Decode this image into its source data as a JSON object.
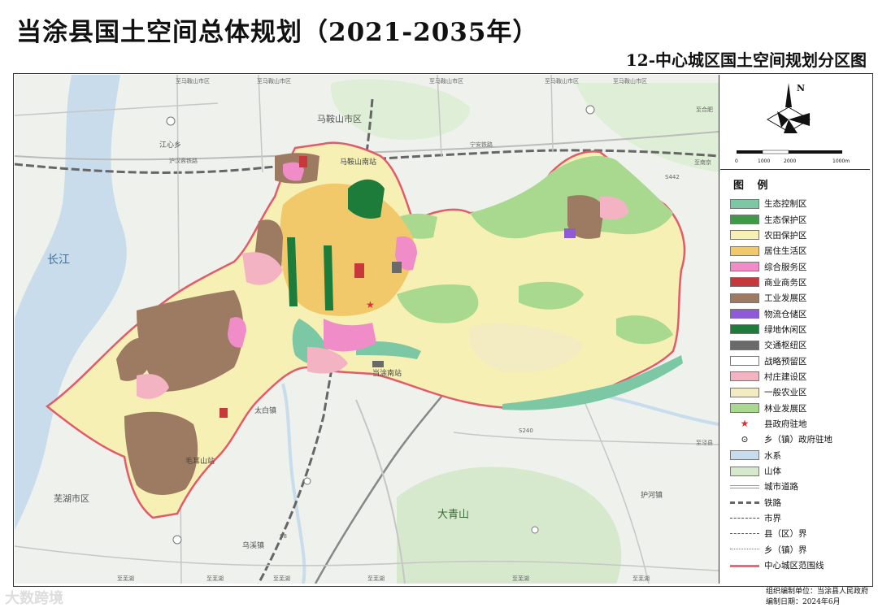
{
  "header": {
    "title": "当涂县国土空间总体规划（2021-2035年）",
    "subtitle": "12-中心城区国土空间规划分区图"
  },
  "compass": {
    "north_label": "N",
    "scale_labels": [
      "0",
      "1000",
      "2000",
      "1000m"
    ]
  },
  "map": {
    "labels": {
      "changjiang": "长江",
      "maanshan": "马鞍山市区",
      "wuhu": "芜湖市区",
      "daqingshan": "大青山",
      "jiangxin": "江心乡",
      "taibai": "太白镇",
      "huyang": "护河镇",
      "wuling": "乌溪镇",
      "dangtu_station": "当涂南站",
      "maanshan_south": "马鞍山南站",
      "maershan": "毛耳山站"
    },
    "road_labels": {
      "zhima_top": "至马鞍山市区",
      "zhima_top2": "至马鞍山市区",
      "zhima_top3": "至马鞍山市区",
      "zhima_top4": "至马鞍山市区",
      "zhima_top5": "至马鞍山市区",
      "zhihe": "至合肥",
      "zhishui": "至泾县",
      "zhinanjing": "至南京",
      "zhiwuhu_b1": "至芜湖",
      "zhiwuhu_b2": "至芜湖",
      "zhiwuhu_b3": "至芜湖",
      "zhiwuhu_b4": "至芜湖",
      "zhiwuhu_b5": "至芜湖",
      "zhiwuhu_b6": "至芜湖",
      "huhan": "沪汉蓉铁路",
      "ningan": "宁安铁路",
      "s442": "S442",
      "s240": "S240",
      "s8": "S8"
    },
    "colors": {
      "background": "#eef1ec",
      "water": "#c9dcec",
      "mountain": "#d7e9cc",
      "eco_control": "#7dc8a4",
      "eco_protect": "#3f9a47",
      "farmland": "#f7f0b4",
      "residential": "#f2c96a",
      "comprehensive": "#f08cc8",
      "commercial": "#c8373a",
      "industrial": "#9c7b62",
      "logistics": "#8e5ad8",
      "green_leisure": "#1d7c3a",
      "transport": "#6a6a6a",
      "strategic": "#ffffff",
      "village": "#f4b3c2",
      "general_agri": "#f3ebc2",
      "forestry": "#a9d98e",
      "boundary": "#e35a6a"
    }
  },
  "legend": {
    "title": "图  例",
    "items": [
      {
        "label": "生态控制区",
        "kind": "fill",
        "color": "#7dc8a4"
      },
      {
        "label": "生态保护区",
        "kind": "fill",
        "color": "#3f9a47"
      },
      {
        "label": "农田保护区",
        "kind": "fill",
        "color": "#f7f0b4"
      },
      {
        "label": "居住生活区",
        "kind": "fill",
        "color": "#f2c96a"
      },
      {
        "label": "综合服务区",
        "kind": "fill",
        "color": "#f08cc8"
      },
      {
        "label": "商业商务区",
        "kind": "fill",
        "color": "#c8373a"
      },
      {
        "label": "工业发展区",
        "kind": "fill",
        "color": "#9c7b62"
      },
      {
        "label": "物流仓储区",
        "kind": "fill",
        "color": "#8e5ad8"
      },
      {
        "label": "绿地休闲区",
        "kind": "fill",
        "color": "#1d7c3a"
      },
      {
        "label": "交通枢纽区",
        "kind": "fill",
        "color": "#6a6a6a"
      },
      {
        "label": "战略预留区",
        "kind": "fill",
        "color": "#ffffff"
      },
      {
        "label": "村庄建设区",
        "kind": "fill",
        "color": "#f4b3c2"
      },
      {
        "label": "一般农业区",
        "kind": "fill",
        "color": "#f3ebc2"
      },
      {
        "label": "林业发展区",
        "kind": "fill",
        "color": "#a9d98e"
      },
      {
        "label": "县政府驻地",
        "kind": "star",
        "color": "#e0303a"
      },
      {
        "label": "乡（镇）政府驻地",
        "kind": "dot",
        "color": "#333333"
      },
      {
        "label": "水系",
        "kind": "fill",
        "color": "#c9dcec"
      },
      {
        "label": "山体",
        "kind": "fill",
        "color": "#d7e9cc"
      },
      {
        "label": "城市道路",
        "kind": "road",
        "color": "#999999"
      },
      {
        "label": "铁路",
        "kind": "rail",
        "color": "#666666"
      },
      {
        "label": "市界",
        "kind": "dash",
        "color": "#444444"
      },
      {
        "label": "县（区）界",
        "kind": "dashdot",
        "color": "#555555"
      },
      {
        "label": "乡（镇）界",
        "kind": "dot-line",
        "color": "#777777"
      },
      {
        "label": "中心城区范围线",
        "kind": "boundary",
        "color": "#e35a6a"
      }
    ]
  },
  "footer": {
    "org": "组织编制单位：当涂县人民政府",
    "date": "编制日期：2024年6月"
  },
  "watermark": "大数跨境"
}
